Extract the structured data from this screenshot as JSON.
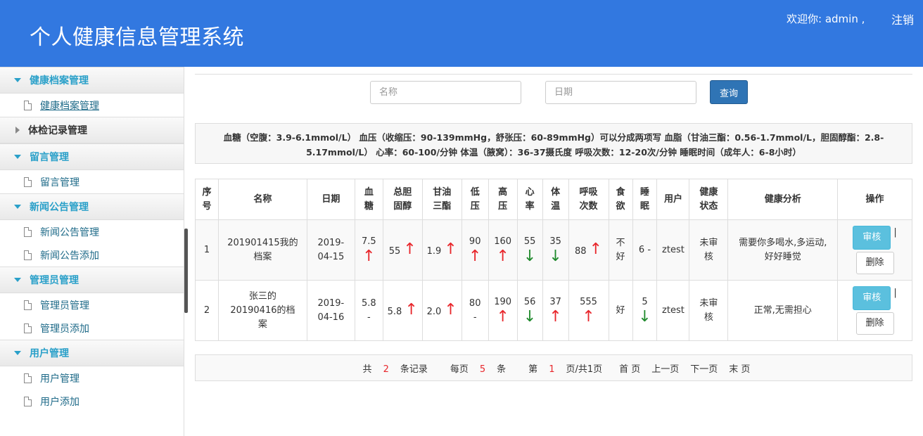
{
  "header": {
    "title": "个人健康信息管理系统",
    "welcome": "欢迎你: admin ,",
    "logout": "注销"
  },
  "sidebar": {
    "groups": [
      {
        "label": "健康档案管理",
        "expanded": true,
        "items": [
          "健康档案管理"
        ]
      },
      {
        "label": "体检记录管理",
        "expanded": false,
        "items": []
      },
      {
        "label": "留言管理",
        "expanded": true,
        "items": [
          "留言管理"
        ]
      },
      {
        "label": "新闻公告管理",
        "expanded": true,
        "items": [
          "新闻公告管理",
          "新闻公告添加"
        ]
      },
      {
        "label": "管理员管理",
        "expanded": true,
        "items": [
          "管理员管理",
          "管理员添加"
        ]
      },
      {
        "label": "用户管理",
        "expanded": true,
        "items": [
          "用户管理",
          "用户添加"
        ]
      }
    ]
  },
  "search": {
    "name_placeholder": "名称",
    "date_placeholder": "日期",
    "query_label": "查询"
  },
  "info_text": "血糖（空腹：3.9-6.1mmol/L） 血压（收缩压：90-139mmHg，舒张压：60-89mmHg）可以分成两项写 血脂（甘油三酯：0.56-1.7mmol/L，胆固醇酯：2.8-5.17mmol/L） 心率：60-100/分钟 体温（腋窝）：36-37摄氏度 呼吸次数：12-20次/分钟 睡眠时间（成年人：6-8小时）",
  "table": {
    "headers": [
      "序号",
      "名称",
      "日期",
      "血糖",
      "总胆固醇",
      "甘油三酯",
      "低压",
      "高压",
      "心率",
      "体温",
      "呼吸次数",
      "食欲",
      "睡眠",
      "用户",
      "健康状态",
      "健康分析",
      "操作"
    ],
    "rows": [
      {
        "no": "1",
        "name": "201901415我的档案",
        "date": "2019-04-15",
        "sugar": "7.5",
        "cholesterol": "55",
        "triglyceride": "1.9",
        "low": "90",
        "high": "160",
        "heart": "55",
        "temp": "35",
        "breath": "88",
        "appetite": "不好",
        "sleep": "6 -",
        "user": "ztest",
        "status": "未审核",
        "analysis": "需要你多喝水,多运动,好好睡觉",
        "approve": "审核",
        "delete": "删除",
        "sep": "|"
      },
      {
        "no": "2",
        "name": "张三的20190416的档案",
        "date": "2019-04-16",
        "sugar": "5.8 -",
        "cholesterol": "5.8",
        "triglyceride": "2.0",
        "low": "80 -",
        "high": "190",
        "heart": "56",
        "temp": "37",
        "breath": "555",
        "appetite": "好",
        "sleep": "5",
        "user": "ztest",
        "status": "未审核",
        "analysis": "正常,无需担心",
        "approve": "审核",
        "delete": "删除",
        "sep": "|"
      }
    ]
  },
  "pager": {
    "total_prefix": "共",
    "total": "2",
    "total_suffix": "条记录",
    "per_prefix": "每页",
    "per": "5",
    "per_suffix": "条",
    "page_prefix": "第",
    "page": "1",
    "page_suffix": "页/共1页",
    "first": "首 页",
    "prev": "上一页",
    "next": "下一页",
    "last": "末 页"
  }
}
